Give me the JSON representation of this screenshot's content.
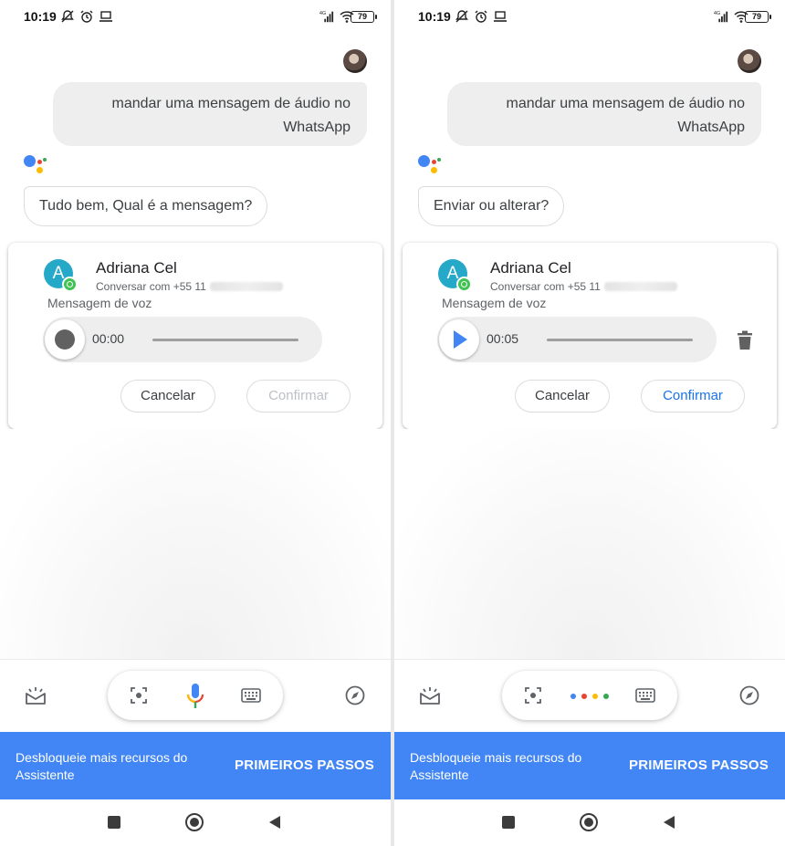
{
  "colors": {
    "accent_blue": "#4285f4",
    "confirm_blue": "#1a73e8",
    "whatsapp_green": "#3fc351",
    "contact_avatar": "#26a9c9",
    "google_red": "#ea4335",
    "google_yellow": "#fbbc04",
    "google_green": "#34a853"
  },
  "status_bar": {
    "time": "10:19",
    "network": "4G",
    "battery": "79"
  },
  "screens": [
    {
      "user_message": "mandar uma mensagem de áudio no WhatsApp",
      "assistant_message": "Tudo bem, Qual é a mensagem?",
      "card": {
        "contact_initial": "A",
        "contact_name": "Adriana Cel",
        "contact_sub": "Conversar com +55 11",
        "voice_label": "Mensagem de voz",
        "player_time": "00:00",
        "player_state": "recording",
        "cancel_label": "Cancelar",
        "confirm_label": "Confirmar",
        "confirm_enabled": false
      },
      "input_mode": "mic"
    },
    {
      "user_message": "mandar uma mensagem de áudio no WhatsApp",
      "assistant_message": "Enviar ou alterar?",
      "card": {
        "contact_initial": "A",
        "contact_name": "Adriana Cel",
        "contact_sub": "Conversar com +55 11",
        "voice_label": "Mensagem de voz",
        "player_time": "00:05",
        "player_state": "recorded",
        "cancel_label": "Cancelar",
        "confirm_label": "Confirmar",
        "confirm_enabled": true
      },
      "input_mode": "listening-dots"
    }
  ],
  "promo": {
    "text": "Desbloqueie mais recursos do Assistente",
    "button": "PRIMEIROS PASSOS"
  },
  "icons": [
    "snapshot-icon",
    "lens-icon",
    "mic-icon",
    "keyboard-icon",
    "compass-icon",
    "trash-icon",
    "play-icon",
    "record-icon",
    "whatsapp-icon",
    "assistant-logo-icon"
  ]
}
